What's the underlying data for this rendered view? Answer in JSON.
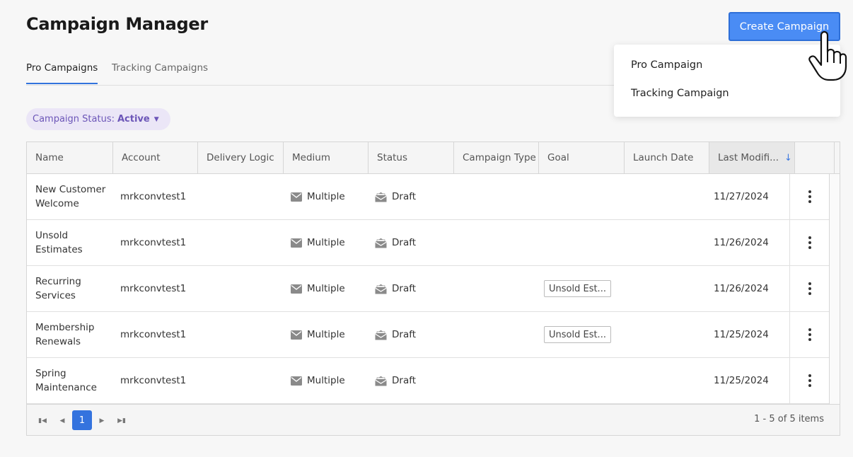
{
  "header": {
    "title": "Campaign Manager",
    "create_button": "Create Campaign"
  },
  "dropdown": {
    "items": [
      "Pro Campaign",
      "Tracking Campaign"
    ]
  },
  "tabs": [
    {
      "label": "Pro Campaigns",
      "active": true
    },
    {
      "label": "Tracking Campaigns",
      "active": false
    }
  ],
  "filter": {
    "label": "Campaign Status:",
    "value": "Active"
  },
  "table": {
    "columns": [
      "Name",
      "Account",
      "Delivery Logic",
      "Medium",
      "Status",
      "Campaign Type",
      "Goal",
      "Launch Date",
      "Last Modifi..."
    ],
    "sorted_column": "Last Modifi...",
    "sort_direction": "descending",
    "rows": [
      {
        "name": "New Customer Welcome",
        "account": "mrkconvtest1",
        "delivery_logic": "",
        "medium": "Multiple",
        "status": "Draft",
        "campaign_type": "",
        "goal": "",
        "launch_date": "",
        "last_modified": "11/27/2024"
      },
      {
        "name": "Unsold Estimates",
        "account": "mrkconvtest1",
        "delivery_logic": "",
        "medium": "Multiple",
        "status": "Draft",
        "campaign_type": "",
        "goal": "",
        "launch_date": "",
        "last_modified": "11/26/2024"
      },
      {
        "name": "Recurring Services",
        "account": "mrkconvtest1",
        "delivery_logic": "",
        "medium": "Multiple",
        "status": "Draft",
        "campaign_type": "",
        "goal": "Unsold Est...",
        "launch_date": "",
        "last_modified": "11/26/2024"
      },
      {
        "name": "Membership Renewals",
        "account": "mrkconvtest1",
        "delivery_logic": "",
        "medium": "Multiple",
        "status": "Draft",
        "campaign_type": "",
        "goal": "Unsold Est...",
        "launch_date": "",
        "last_modified": "11/25/2024"
      },
      {
        "name": "Spring Maintenance",
        "account": "mrkconvtest1",
        "delivery_logic": "",
        "medium": "Multiple",
        "status": "Draft",
        "campaign_type": "",
        "goal": "",
        "launch_date": "",
        "last_modified": "11/25/2024"
      }
    ]
  },
  "pagination": {
    "current_page": "1",
    "summary": "1 - 5 of 5 items"
  },
  "icons": {
    "medium": "envelope-icon",
    "status": "open-envelope-icon",
    "actions": "kebab-menu-icon",
    "cursor": "hand-pointer-icon"
  },
  "colors": {
    "primary": "#4a8cf4",
    "tab_underline": "#3373dc",
    "chip_bg": "#ebe6f7",
    "chip_text": "#6c56b8",
    "page_active": "#3473de"
  }
}
